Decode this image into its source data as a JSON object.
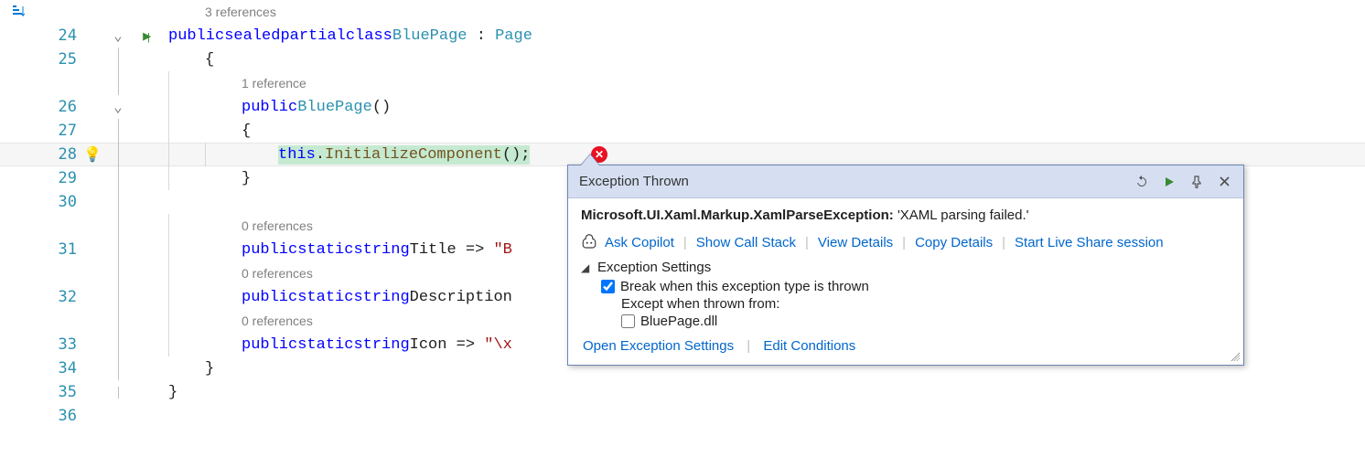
{
  "lines": {
    "l23_ref": "3 references",
    "l24_num": "24",
    "l24": {
      "kw1": "public",
      "kw2": "sealed",
      "kw3": "partial",
      "kw4": "class",
      "type": "BluePage",
      "colon": " : ",
      "base": "Page"
    },
    "l25_num": "25",
    "l25": "{",
    "l25_ref": "1 reference",
    "l26_num": "26",
    "l26": {
      "kw": "public",
      "ctor": "BluePage",
      "parens": "()"
    },
    "l27_num": "27",
    "l27": "{",
    "l28_num": "28",
    "l28": {
      "thiskw": "this",
      "dot": ".",
      "fn": "InitializeComponent",
      "tail": "();"
    },
    "l29_num": "29",
    "l29": "}",
    "l30_num": "30",
    "l30_ref_a": "0 references",
    "l31_num": "31",
    "l31": {
      "kw1": "public",
      "kw2": "static",
      "kw3": "string",
      "id": "Title",
      "arrow": " => ",
      "str": "\"B"
    },
    "l31_ref_b": "0 references",
    "l32_num": "32",
    "l32": {
      "kw1": "public",
      "kw2": "static",
      "kw3": "string",
      "id": "Description"
    },
    "l32_ref_b": "0 references",
    "l33_num": "33",
    "l33": {
      "kw1": "public",
      "kw2": "static",
      "kw3": "string",
      "id": "Icon",
      "arrow": " => ",
      "str": "\"\\x"
    },
    "l34_num": "34",
    "l34": "}",
    "l35_num": "35",
    "l35": "}",
    "l36_num": "36"
  },
  "exception": {
    "title": "Exception Thrown",
    "type": "Microsoft.UI.Xaml.Markup.XamlParseException:",
    "message": "'XAML parsing failed.'",
    "links": {
      "copilot": "Ask Copilot",
      "callstack": "Show Call Stack",
      "details": "View Details",
      "copy": "Copy Details",
      "liveshare": "Start Live Share session"
    },
    "settings_header": "Exception Settings",
    "break_label": "Break when this exception type is thrown",
    "except_label": "Except when thrown from:",
    "except_item": "BluePage.dll",
    "footer": {
      "open_settings": "Open Exception Settings",
      "edit_conditions": "Edit Conditions"
    }
  }
}
